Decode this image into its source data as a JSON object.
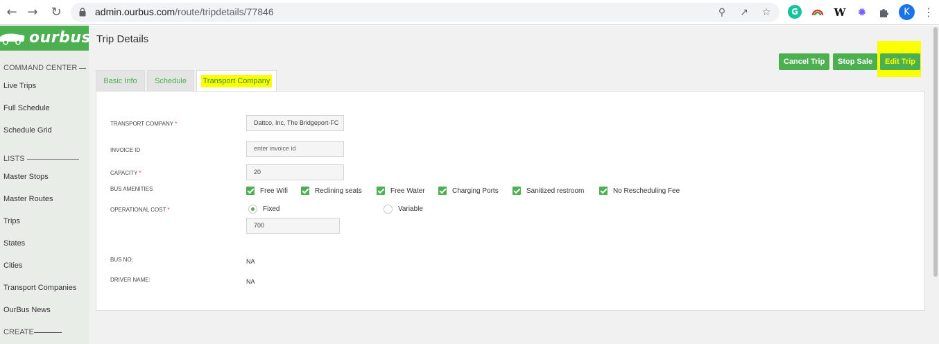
{
  "browser": {
    "url_host": "admin.ourbus.com",
    "url_path": "/route/tripdetails/77846",
    "profile_initial": "K",
    "icons": [
      "back-icon",
      "forward-icon",
      "reload-icon",
      "lock-icon",
      "zoom-icon",
      "share-icon",
      "star-icon",
      "grammarly-icon",
      "rainbow-extension-icon",
      "wikipedia-icon",
      "gear-extension-icon",
      "puzzle-icon",
      "menu-dots-icon"
    ]
  },
  "sidebar": {
    "logo": "ourbus",
    "sections": {
      "command_center": "COMMAND CENTER",
      "lists": "LISTS",
      "create": "CREATE"
    },
    "items": [
      {
        "label": "Live Trips"
      },
      {
        "label": "Full Schedule"
      },
      {
        "label": "Schedule Grid"
      },
      {
        "label": "Master Stops"
      },
      {
        "label": "Master Routes"
      },
      {
        "label": "Trips"
      },
      {
        "label": "States"
      },
      {
        "label": "Cities"
      },
      {
        "label": "Transport Companies"
      },
      {
        "label": "OurBus News"
      }
    ]
  },
  "main": {
    "title": "Trip Details",
    "buttons": {
      "cancel_trip": "Cancel Trip",
      "stop_sale": "Stop Sale",
      "edit_trip": "Edit Trip"
    },
    "tabs": [
      {
        "label": "Basic Info"
      },
      {
        "label": "Schedule"
      },
      {
        "label": "Transport Company"
      }
    ],
    "form": {
      "transport_company_label": "TRANSPORT COMPANY",
      "transport_company_value": "Dattco, Inc, The Bridgeport-FC",
      "invoice_id_label": "INVOICE ID",
      "invoice_id_placeholder": "enter invoice id",
      "capacity_label": "CAPACITY",
      "capacity_value": "20",
      "amenities_label": "BUS AMENITIES",
      "amenities": [
        {
          "label": "Free Wifi",
          "checked": true
        },
        {
          "label": "Reclining seats",
          "checked": true
        },
        {
          "label": "Free Water",
          "checked": true
        },
        {
          "label": "Charging Ports",
          "checked": true
        },
        {
          "label": "Sanitized restroom",
          "checked": true
        },
        {
          "label": "No Rescheduling Fee",
          "checked": true
        }
      ],
      "operational_cost_label": "OPERATIONAL COST",
      "cost_type_options": [
        {
          "label": "Fixed",
          "selected": true
        },
        {
          "label": "Variable",
          "selected": false
        }
      ],
      "cost_value": "700",
      "bus_no_label": "BUS NO:",
      "bus_no_value": "NA",
      "driver_name_label": "DRIVER NAME:",
      "driver_name_value": "NA",
      "required_mark": "*"
    }
  },
  "colors": {
    "brand_green": "#4caf50",
    "highlight_yellow": "#fcff00",
    "sidebar_bg": "#e9ede8",
    "required_red": "#e53935"
  }
}
